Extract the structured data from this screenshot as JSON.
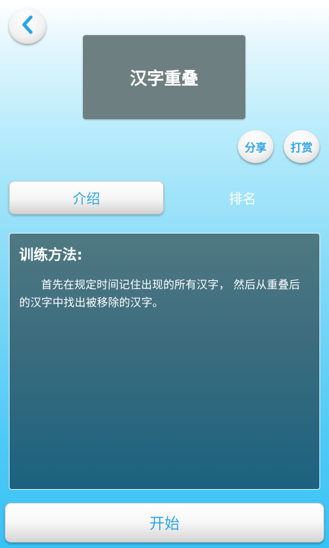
{
  "header": {
    "back_icon": "chevron-left-icon",
    "title": "汉字重叠"
  },
  "actions": {
    "share_label": "分享",
    "reward_label": "打赏"
  },
  "tabs": [
    {
      "label": "介绍",
      "selected": true
    },
    {
      "label": "排名",
      "selected": false
    }
  ],
  "description": {
    "heading": "训练方法:",
    "text": "首先在规定时间记住出现的所有汉字， 然后从重叠后的汉字中找出被移除的汉字。"
  },
  "start_button": {
    "label": "开始"
  },
  "colors": {
    "accent": "#2ba5e6",
    "title_box": "#6e7f82",
    "panel_top": "#4f7982",
    "panel_bottom": "#1b627f"
  }
}
